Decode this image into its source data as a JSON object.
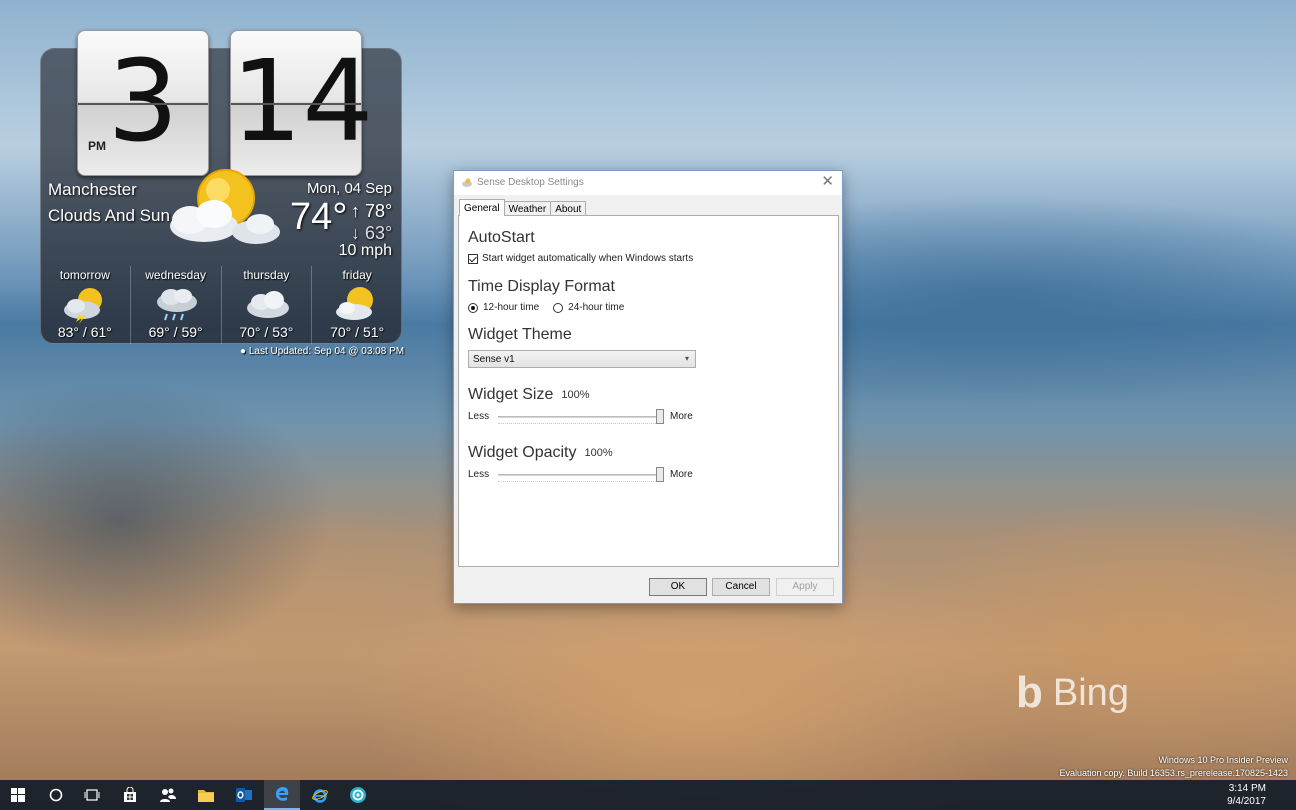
{
  "widget": {
    "hour": "3",
    "minute": "14",
    "ampm": "PM",
    "city": "Manchester",
    "condition": "Clouds And Sun",
    "date": "Mon, 04 Sep",
    "temperature": "74°",
    "high": "↑ 78°",
    "low": "↓ 63°",
    "wind": "10 mph",
    "forecast": [
      {
        "day": "tomorrow",
        "temps": "83° / 61°",
        "icon": "storm-sun-icon"
      },
      {
        "day": "wednesday",
        "temps": "69° / 59°",
        "icon": "rain-cloud-icon"
      },
      {
        "day": "thursday",
        "temps": "70° / 53°",
        "icon": "cloud-icon"
      },
      {
        "day": "friday",
        "temps": "70° / 51°",
        "icon": "sun-cloud-icon"
      }
    ],
    "last_updated": "Last Updated: Sep 04 @ 03:08 PM"
  },
  "dialog": {
    "title": "Sense Desktop Settings",
    "close_glyph": "✕",
    "tabs": [
      "General",
      "Weather",
      "About"
    ],
    "active_tab": "General",
    "autostart": {
      "title": "AutoStart",
      "checkbox_label": "Start widget automatically when Windows starts",
      "checked": true
    },
    "time_format": {
      "title": "Time Display Format",
      "options": [
        "12-hour time",
        "24-hour time"
      ],
      "selected": "12-hour time"
    },
    "theme": {
      "title": "Widget Theme",
      "value": "Sense v1"
    },
    "size": {
      "title": "Widget Size",
      "percent": "100%",
      "less": "Less",
      "more": "More",
      "value": 100
    },
    "opacity": {
      "title": "Widget Opacity",
      "percent": "100%",
      "less": "Less",
      "more": "More",
      "value": 100
    },
    "buttons": {
      "ok": "OK",
      "cancel": "Cancel",
      "apply": "Apply"
    }
  },
  "watermark": {
    "brand": "Bing",
    "build_line1": "Windows 10 Pro Insider Preview",
    "build_line2": "Evaluation copy. Build 16353.rs_prerelease.170825-1423"
  },
  "taskbar": {
    "time": "3:14 PM",
    "date": "9/4/2017",
    "items": [
      "start-icon",
      "cortana-icon",
      "task-view-icon",
      "store-icon",
      "people-icon",
      "file-explorer-icon",
      "outlook-icon",
      "edge-icon",
      "internet-explorer-icon",
      "sense-app-icon"
    ]
  },
  "colors": {
    "accent": "#7fb2e8",
    "taskbar": "#121c28"
  }
}
